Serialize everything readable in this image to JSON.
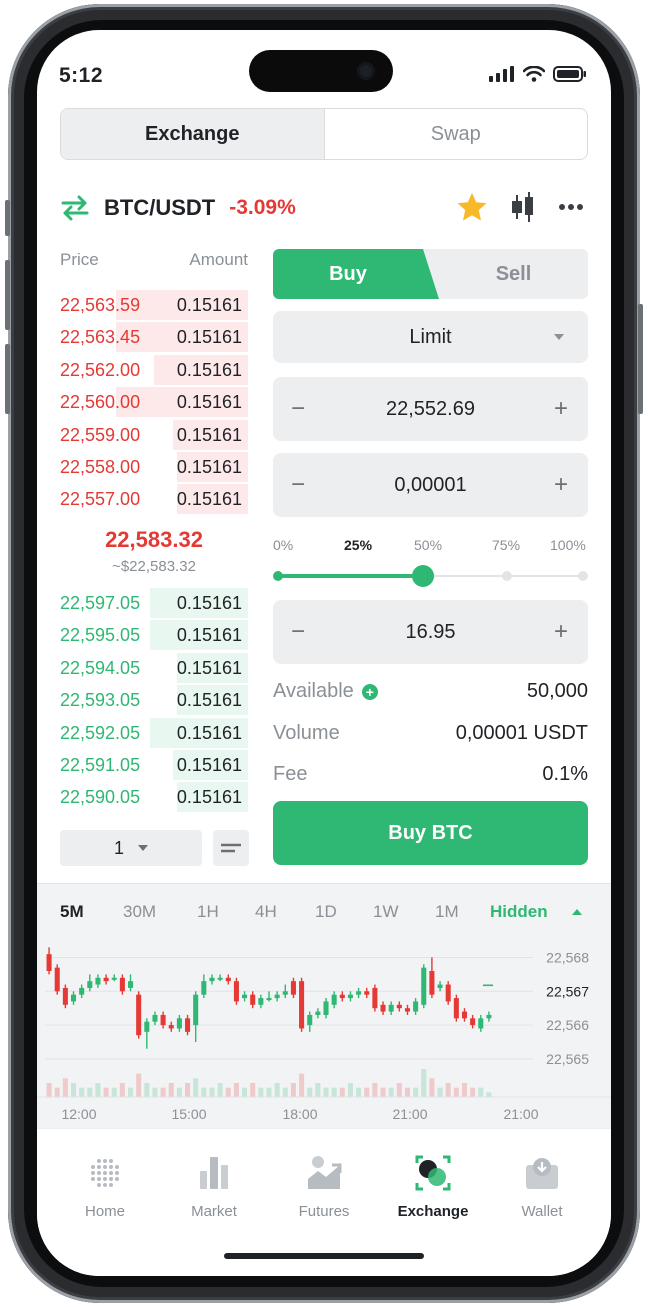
{
  "status_bar": {
    "time": "5:12"
  },
  "tabs": [
    {
      "label": "Exchange",
      "active": true
    },
    {
      "label": "Swap",
      "active": false
    }
  ],
  "pair": {
    "name": "BTC/USDT",
    "change": "-3.09%",
    "favorite": true,
    "icons": [
      "swap-arrows-icon",
      "star-icon",
      "candlestick-icon",
      "more-icon"
    ]
  },
  "order_book": {
    "price_header": "Price",
    "amount_header": "Amount",
    "asks": [
      {
        "price": "22,563.59",
        "amount": "0.15161",
        "depth": 0.7
      },
      {
        "price": "22,563.45",
        "amount": "0.15161",
        "depth": 0.7
      },
      {
        "price": "22,562.00",
        "amount": "0.15161",
        "depth": 0.5
      },
      {
        "price": "22,560.00",
        "amount": "0.15161",
        "depth": 0.7
      },
      {
        "price": "22,559.00",
        "amount": "0.15161",
        "depth": 0.4
      },
      {
        "price": "22,558.00",
        "amount": "0.15161",
        "depth": 0.38
      },
      {
        "price": "22,557.00",
        "amount": "0.15161",
        "depth": 0.38
      }
    ],
    "mid_price": "22,583.32",
    "mid_price_usd": "~$22,583.32",
    "bids": [
      {
        "price": "22,597.05",
        "amount": "0.15161",
        "depth": 0.52
      },
      {
        "price": "22,595.05",
        "amount": "0.15161",
        "depth": 0.52
      },
      {
        "price": "22,594.05",
        "amount": "0.15161",
        "depth": 0.38
      },
      {
        "price": "22,593.05",
        "amount": "0.15161",
        "depth": 0.38
      },
      {
        "price": "22,592.05",
        "amount": "0.15161",
        "depth": 0.52
      },
      {
        "price": "22,591.05",
        "amount": "0.15161",
        "depth": 0.4
      },
      {
        "price": "22,590.05",
        "amount": "0.15161",
        "depth": 0.38
      }
    ],
    "depth_value": "1"
  },
  "trade": {
    "buy_label": "Buy",
    "sell_label": "Sell",
    "order_type": "Limit",
    "price": "22,552.69",
    "amount": "0,00001",
    "total": "16.95",
    "percent_marks": [
      "0%",
      "25%",
      "50%",
      "75%",
      "100%"
    ],
    "percent_selected": 25,
    "available_label": "Available",
    "available_value": "50,000",
    "volume_label": "Volume",
    "volume_value": "0,00001 USDT",
    "fee_label": "Fee",
    "fee_value": "0.1%",
    "submit_label": "Buy BTC"
  },
  "chart": {
    "timeframes": [
      "5M",
      "30M",
      "1H",
      "4H",
      "1D",
      "1W",
      "1M"
    ],
    "active_timeframe": "5M",
    "toggle_label": "Hidden",
    "colors": {
      "up": "#2fb873",
      "down": "#e53935"
    }
  },
  "chart_data": {
    "type": "candlestick",
    "y_ticks": [
      "22,568",
      "22,567",
      "22,566",
      "22,565"
    ],
    "ylim": [
      22564.7,
      22568.4
    ],
    "x_ticks": [
      "12:00",
      "15:00",
      "18:00",
      "21:00",
      "21:00"
    ],
    "candles": [
      [
        22568.1,
        22567.6,
        22568.3,
        22567.5
      ],
      [
        22567.7,
        22567.0,
        22567.8,
        22566.9
      ],
      [
        22567.1,
        22566.6,
        22567.2,
        22566.5
      ],
      [
        22566.7,
        22566.9,
        22567.0,
        22566.6
      ],
      [
        22566.9,
        22567.1,
        22567.2,
        22566.8
      ],
      [
        22567.1,
        22567.3,
        22567.5,
        22567.0
      ],
      [
        22567.2,
        22567.4,
        22567.5,
        22567.1
      ],
      [
        22567.4,
        22567.3,
        22567.5,
        22567.2
      ],
      [
        22567.4,
        22567.4,
        22567.5,
        22567.3
      ],
      [
        22567.4,
        22567.0,
        22567.5,
        22566.9
      ],
      [
        22567.1,
        22567.3,
        22567.5,
        22567.0
      ],
      [
        22566.9,
        22565.7,
        22567.0,
        22565.6
      ],
      [
        22565.8,
        22566.1,
        22566.2,
        22565.3
      ],
      [
        22566.1,
        22566.3,
        22566.4,
        22566.0
      ],
      [
        22566.3,
        22566.0,
        22566.4,
        22565.9
      ],
      [
        22566.0,
        22565.9,
        22566.1,
        22565.8
      ],
      [
        22565.9,
        22566.2,
        22566.3,
        22565.8
      ],
      [
        22566.2,
        22565.8,
        22566.3,
        22565.7
      ],
      [
        22566.0,
        22566.9,
        22567.0,
        22565.5
      ],
      [
        22566.9,
        22567.3,
        22567.5,
        22566.8
      ],
      [
        22567.3,
        22567.4,
        22567.5,
        22567.2
      ],
      [
        22567.4,
        22567.4,
        22567.5,
        22567.3
      ],
      [
        22567.4,
        22567.3,
        22567.5,
        22567.2
      ],
      [
        22567.3,
        22566.7,
        22567.4,
        22566.6
      ],
      [
        22566.8,
        22566.9,
        22567.0,
        22566.7
      ],
      [
        22566.9,
        22566.6,
        22567.0,
        22566.5
      ],
      [
        22566.6,
        22566.8,
        22566.9,
        22566.5
      ],
      [
        22566.8,
        22566.8,
        22567.0,
        22566.7
      ],
      [
        22566.8,
        22566.9,
        22567.0,
        22566.7
      ],
      [
        22566.9,
        22567.0,
        22567.2,
        22566.8
      ],
      [
        22567.3,
        22566.9,
        22567.4,
        22566.8
      ],
      [
        22567.3,
        22565.9,
        22567.4,
        22565.8
      ],
      [
        22566.0,
        22566.3,
        22566.4,
        22565.8
      ],
      [
        22566.3,
        22566.4,
        22566.5,
        22566.2
      ],
      [
        22566.3,
        22566.7,
        22566.8,
        22566.2
      ],
      [
        22566.6,
        22566.9,
        22567.0,
        22566.5
      ],
      [
        22566.9,
        22566.8,
        22567.0,
        22566.7
      ],
      [
        22566.8,
        22566.9,
        22567.0,
        22566.7
      ],
      [
        22566.9,
        22567.0,
        22567.1,
        22566.8
      ],
      [
        22567.0,
        22566.9,
        22567.1,
        22566.8
      ],
      [
        22567.1,
        22566.5,
        22567.2,
        22566.4
      ],
      [
        22566.6,
        22566.4,
        22566.7,
        22566.3
      ],
      [
        22566.4,
        22566.6,
        22566.7,
        22566.3
      ],
      [
        22566.6,
        22566.5,
        22566.7,
        22566.4
      ],
      [
        22566.5,
        22566.4,
        22566.6,
        22566.3
      ],
      [
        22566.4,
        22566.7,
        22566.8,
        22566.3
      ],
      [
        22566.6,
        22567.7,
        22567.8,
        22566.5
      ],
      [
        22567.6,
        22566.9,
        22568.0,
        22566.8
      ],
      [
        22567.1,
        22567.2,
        22567.3,
        22567.0
      ],
      [
        22567.2,
        22566.7,
        22567.3,
        22566.6
      ],
      [
        22566.8,
        22566.2,
        22566.9,
        22566.1
      ],
      [
        22566.4,
        22566.2,
        22566.5,
        22566.1
      ],
      [
        22566.2,
        22566.0,
        22566.3,
        22565.9
      ],
      [
        22565.9,
        22566.2,
        22566.3,
        22565.8
      ],
      [
        22566.2,
        22566.3,
        22566.4,
        22566.1
      ]
    ],
    "volume": [
      3,
      2,
      4,
      3,
      2,
      2,
      3,
      2,
      2,
      3,
      2,
      5,
      3,
      2,
      2,
      3,
      2,
      3,
      4,
      2,
      2,
      3,
      2,
      3,
      2,
      3,
      2,
      2,
      3,
      2,
      3,
      5,
      2,
      3,
      2,
      2,
      2,
      3,
      2,
      2,
      3,
      2,
      2,
      3,
      2,
      2,
      6,
      4,
      2,
      3,
      2,
      3,
      2,
      2,
      1
    ]
  },
  "nav": [
    {
      "label": "Home",
      "icon": "home-icon",
      "active": false
    },
    {
      "label": "Market",
      "icon": "market-icon",
      "active": false
    },
    {
      "label": "Futures",
      "icon": "futures-icon",
      "active": false
    },
    {
      "label": "Exchange",
      "icon": "exchange-icon",
      "active": true
    },
    {
      "label": "Wallet",
      "icon": "wallet-icon",
      "active": false
    }
  ]
}
